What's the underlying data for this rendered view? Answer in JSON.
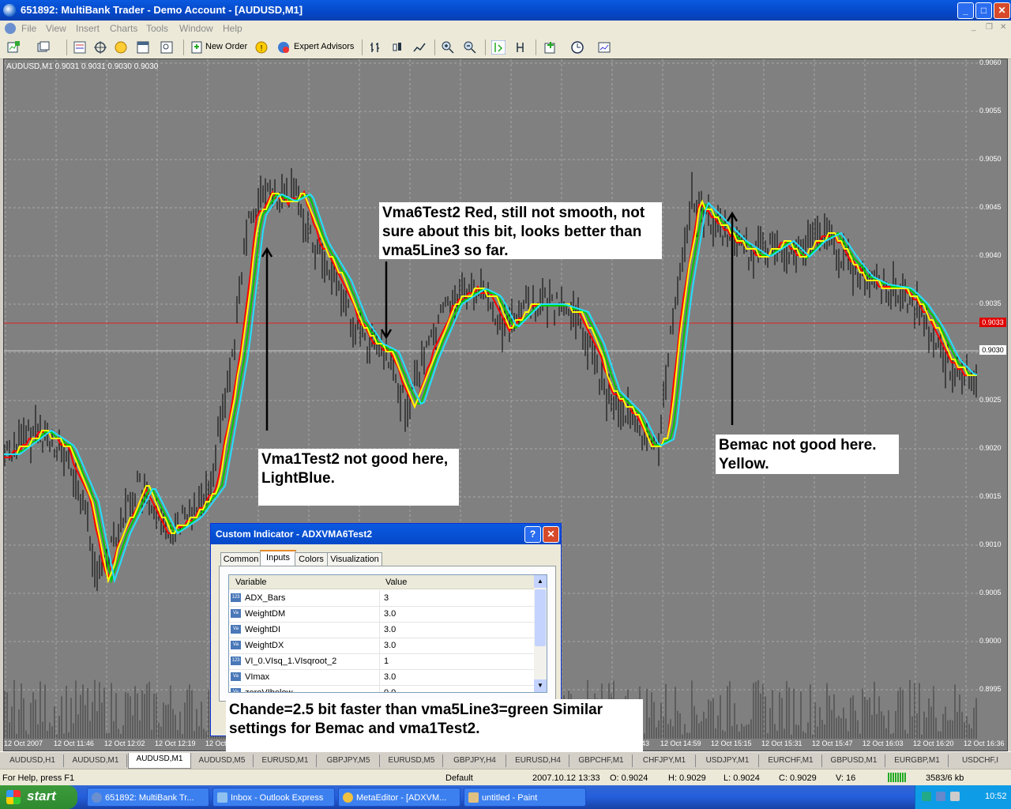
{
  "window": {
    "title": "651892: MultiBank Trader - Demo Account - [AUDUSD,M1]"
  },
  "menu": [
    "File",
    "View",
    "Insert",
    "Charts",
    "Tools",
    "Window",
    "Help"
  ],
  "toolbar": {
    "new_order": "New Order",
    "expert_advisors": "Expert Advisors"
  },
  "chart": {
    "label": "AUDUSD,M1  0.9031 0.9031 0.9030 0.9030",
    "price_ticks": [
      "0.9060",
      "0.9055",
      "0.9050",
      "0.9045",
      "0.9040",
      "0.9035",
      "0.9030",
      "0.9025",
      "0.9020",
      "0.9015",
      "0.9010",
      "0.9005",
      "0.9000",
      "0.8995"
    ],
    "current_price": "0.9033",
    "bid_price": "0.9030",
    "time_ticks": [
      "12 Oct 2007",
      "12 Oct 11:46",
      "12 Oct 12:02",
      "12 Oct 12:19",
      "12 Oct",
      "43",
      "12 Oct 14:59",
      "12 Oct 15:15",
      "12 Oct 15:31",
      "12 Oct 15:47",
      "12 Oct 16:03",
      "12 Oct 16:20",
      "12 Oct 16:36"
    ],
    "colors": {
      "background": "#808080",
      "grid": "#a8a8a8",
      "candles": "#000000",
      "red": "#ff0000",
      "green": "#00cc00",
      "yellow": "#ffff00",
      "lightblue": "#22e0ff",
      "price_line": "#e02020"
    }
  },
  "annotations": {
    "vma6": "Vma6Test2 Red, still not smooth, not sure about this bit, looks better than vma5Line3 so far.",
    "vma1": "Vma1Test2 not good here, LightBlue.",
    "bemac": "Bemac not good here. Yellow.",
    "chande": "Chande=2.5 bit faster than vma5Line3=green Similar settings for Bemac and vma1Test2."
  },
  "dialog": {
    "title": "Custom Indicator - ADXVMA6Test2",
    "help": "?",
    "tabs": [
      "Common",
      "Inputs",
      "Colors",
      "Visualization"
    ],
    "active_tab": "Inputs",
    "columns": [
      "Variable",
      "Value"
    ],
    "rows": [
      {
        "icon": "123",
        "name": "ADX_Bars",
        "value": "3"
      },
      {
        "icon": "Va",
        "name": "WeightDM",
        "value": "3.0"
      },
      {
        "icon": "Va",
        "name": "WeightDI",
        "value": "3.0"
      },
      {
        "icon": "Va",
        "name": "WeightDX",
        "value": "3.0"
      },
      {
        "icon": "123",
        "name": "VI_0.VIsq_1.VIsqroot_2",
        "value": "1"
      },
      {
        "icon": "Va",
        "name": "VImax",
        "value": "3.0"
      },
      {
        "icon": "Va",
        "name": "zeroVIbelow",
        "value": "0.0"
      }
    ]
  },
  "symbol_tabs": [
    "AUDUSD,H1",
    "AUDUSD,M1",
    "AUDUSD,M1",
    "AUDUSD,M5",
    "EURUSD,M1",
    "GBPJPY,M5",
    "EURUSD,M5",
    "GBPJPY,H4",
    "EURUSD,H4",
    "GBPCHF,M1",
    "CHFJPY,M1",
    "USDJPY,M1",
    "EURCHF,M1",
    "GBPUSD,M1",
    "EURGBP,M1",
    "USDCHF,I"
  ],
  "active_symbol_tab": 2,
  "status": {
    "help": "For Help, press F1",
    "profile": "Default",
    "time": "2007.10.12 13:33",
    "open": "O: 0.9024",
    "high": "H: 0.9029",
    "low": "L: 0.9024",
    "close": "C: 0.9029",
    "volume": "V: 16",
    "traffic": "3583/6 kb"
  },
  "taskbar": {
    "start": "start",
    "tasks": [
      "651892: MultiBank Tr...",
      "Inbox - Outlook Express",
      "MetaEditor - [ADXVM...",
      "untitled - Paint"
    ],
    "clock": "10:52"
  }
}
